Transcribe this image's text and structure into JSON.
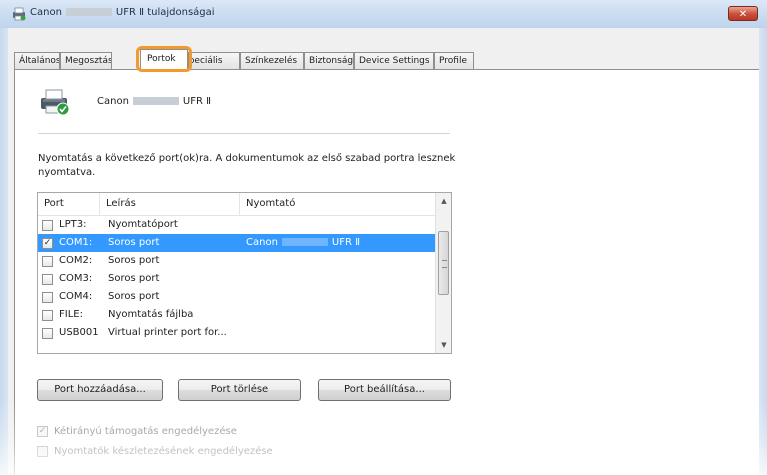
{
  "window": {
    "title_prefix": "Canon",
    "title_suffix": "UFR Ⅱ tulajdonságai",
    "close_glyph": "✕"
  },
  "tabs": [
    {
      "label": "Általános"
    },
    {
      "label": "Megosztás"
    },
    {
      "label": "Portok",
      "active": true
    },
    {
      "label": "Speciális"
    },
    {
      "label": "Színkezelés"
    },
    {
      "label": "Biztonság"
    },
    {
      "label": "Device Settings"
    },
    {
      "label": "Profile"
    }
  ],
  "printer": {
    "name_prefix": "Canon",
    "name_suffix": "UFR Ⅱ"
  },
  "description": "Nyomtatás a következő port(ok)ra. A dokumentumok az első szabad portra lesznek nyomtatva.",
  "ports": {
    "columns": [
      "Port",
      "Leírás",
      "Nyomtató"
    ],
    "rows": [
      {
        "port": "LPT3:",
        "description": "Nyomtatóport",
        "printer": "",
        "checked": false,
        "selected": false
      },
      {
        "port": "COM1:",
        "description": "Soros port",
        "printer": "Canon",
        "printer_suffix": "UFR Ⅱ",
        "checked": true,
        "selected": true
      },
      {
        "port": "COM2:",
        "description": "Soros port",
        "printer": "",
        "checked": false,
        "selected": false
      },
      {
        "port": "COM3:",
        "description": "Soros port",
        "printer": "",
        "checked": false,
        "selected": false
      },
      {
        "port": "COM4:",
        "description": "Soros port",
        "printer": "",
        "checked": false,
        "selected": false
      },
      {
        "port": "FILE:",
        "description": "Nyomtatás fájlba",
        "printer": "",
        "checked": false,
        "selected": false
      },
      {
        "port": "USB001",
        "description": "Virtual printer port for...",
        "printer": "",
        "checked": false,
        "selected": false
      }
    ]
  },
  "buttons": {
    "add_port": "Port hozzáadása...",
    "delete_port": "Port törlése",
    "configure_port": "Port beállítása..."
  },
  "options": {
    "bidirectional": {
      "label": "Kétirányú támogatás engedélyezése",
      "checked": true
    },
    "pooling": {
      "label": "Nyomtatók készletezésének engedélyezése",
      "checked": false
    }
  },
  "icons": {
    "printer": "printer-icon",
    "check": "checkmark-icon"
  }
}
